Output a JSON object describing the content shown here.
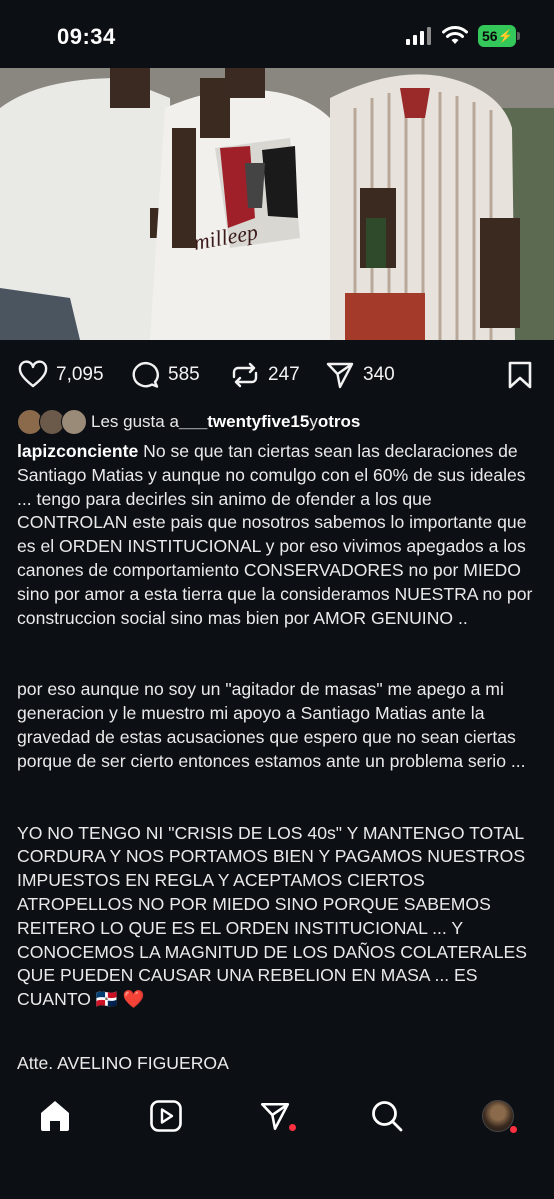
{
  "status_bar": {
    "time": "09:34",
    "battery_level": "56"
  },
  "post": {
    "photo": "image-post-photo",
    "stats": {
      "likes": "7,095",
      "comments": "585",
      "reposts": "247",
      "shares": "340"
    },
    "liked_by": {
      "prefix": "Les gusta a ",
      "user": "___twentyfive15",
      "middle": " y ",
      "others": "otros"
    },
    "caption": {
      "username": "lapizconciente",
      "paragraph1": " No se que tan ciertas sean las declaraciones de Santiago Matias y aunque no comulgo con el 60% de sus ideales ... tengo para decirles sin animo de ofender a los que CONTROLAN este pais que nosotros sabemos lo importante que es el ORDEN INSTITUCIONAL y por eso vivimos apegados a los canones de comportamiento CONSERVADORES no por MIEDO sino por amor a esta tierra que la consideramos NUESTRA no por construccion social sino mas bien por AMOR GENUINO ..",
      "paragraph2": "por eso aunque no soy un \"agitador de masas\" me apego a mi generacion y le muestro mi apoyo a Santiago Matias  ante la gravedad de estas acusaciones que espero que no sean ciertas porque de ser cierto entonces estamos ante un problema serio ...",
      "paragraph3": "YO NO TENGO NI \"CRISIS DE LOS 40s\" Y MANTENGO TOTAL CORDURA Y NOS PORTAMOS BIEN Y PAGAMOS NUESTROS IMPUESTOS EN REGLA Y ACEPTAMOS CIERTOS ATROPELLOS NO POR MIEDO SINO PORQUE SABEMOS REITERO LO QUE ES EL ORDEN INSTITUCIONAL ... Y CONOCEMOS LA MAGNITUD DE LOS DAÑOS COLATERALES QUE PUEDEN CAUSAR UNA REBELION EN MASA ... ES CUANTO ",
      "emoji": "🇩🇴 ❤️",
      "signature": "Atte. AVELINO FIGUEROA"
    }
  },
  "tab_bar": {
    "icons": [
      "home-icon",
      "reels-icon",
      "send-icon",
      "search-icon",
      "profile-avatar"
    ]
  },
  "colors": {
    "background": "#0c0f14",
    "notification_dot": "#ff3040",
    "battery": "#34c759"
  }
}
